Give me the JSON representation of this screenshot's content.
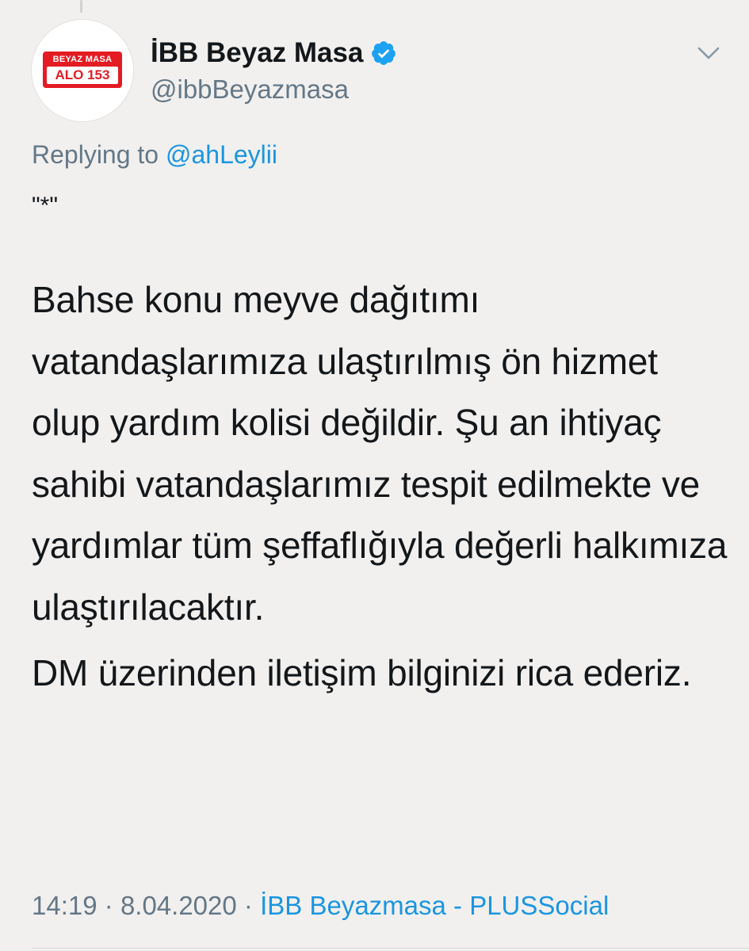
{
  "tweet": {
    "avatar": {
      "top_text": "BEYAZ MASA",
      "bottom_text": "ALO 153",
      "brand_color": "#e41b23"
    },
    "display_name": "İBB Beyaz Masa",
    "verified": true,
    "verified_icon": "verified-badge-icon",
    "handle": "@ibbBeyazmasa",
    "menu_icon": "chevron-down-icon",
    "replying_prefix": "Replying to",
    "replying_to": "@ahLeylii",
    "quote_mark": "\"*\"",
    "body_paragraph_1": "Bahse konu meyve dağıtımı vatandaşlarımıza ulaştırılmış ön hizmet olup yardım kolisi değildir. Şu an ihtiyaç sahibi vatandaşlarımız tespit edilmekte ve yardımlar tüm şeffaflığıyla değerli halkımıza ulaştırılacaktır.",
    "body_paragraph_2": "DM üzerinden iletişim bilginizi rica ederiz.",
    "time": "14:19",
    "separator": "·",
    "date": "8.04.2020",
    "source": "İBB Beyazmasa - PLUSSocial"
  },
  "colors": {
    "background": "#f1f0ef",
    "text": "#14171a",
    "muted": "#657786",
    "link": "#1b95e0",
    "verified": "#1da1f2"
  }
}
